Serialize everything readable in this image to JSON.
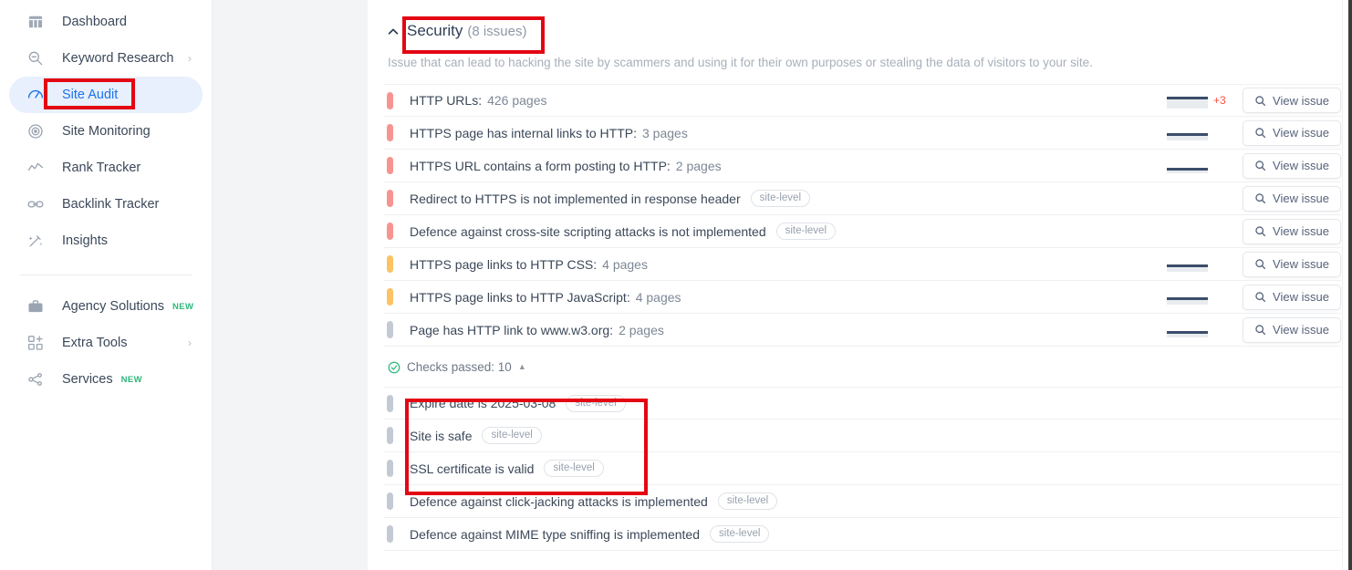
{
  "sidebar": {
    "items": [
      {
        "label": "Dashboard",
        "icon": "dashboard-icon",
        "caret": "",
        "badge": ""
      },
      {
        "label": "Keyword Research",
        "icon": "keyword-research-icon",
        "caret": "›",
        "badge": ""
      },
      {
        "label": "Site Audit",
        "icon": "site-audit-icon",
        "caret": "",
        "badge": "",
        "active": true
      },
      {
        "label": "Site Monitoring",
        "icon": "site-monitoring-icon",
        "caret": "",
        "badge": ""
      },
      {
        "label": "Rank Tracker",
        "icon": "rank-tracker-icon",
        "caret": "",
        "badge": ""
      },
      {
        "label": "Backlink Tracker",
        "icon": "backlink-tracker-icon",
        "caret": "",
        "badge": ""
      },
      {
        "label": "Insights",
        "icon": "insights-icon",
        "caret": "",
        "badge": ""
      }
    ],
    "items_secondary": [
      {
        "label": "Agency Solutions",
        "icon": "briefcase-icon",
        "caret": "",
        "badge": "NEW"
      },
      {
        "label": "Extra Tools",
        "icon": "extra-tools-icon",
        "caret": "›",
        "badge": ""
      },
      {
        "label": "Services",
        "icon": "services-icon",
        "caret": "",
        "badge": "NEW"
      }
    ]
  },
  "section": {
    "title": "Security",
    "count": "(8 issues)",
    "description": "Issue that can lead to hacking the site by scammers and using it for their own purposes or stealing the data of visitors to your site.",
    "collapse_icon": "chevron-up-icon"
  },
  "issues": [
    {
      "severity": "red",
      "label": "HTTP URLs:",
      "count": "426 pages",
      "pill": "",
      "spark": true,
      "spark_fill": 62,
      "delta": "+3",
      "button": "View issue"
    },
    {
      "severity": "red",
      "label": "HTTPS page has internal links to HTTP:",
      "count": "3 pages",
      "pill": "",
      "spark": true,
      "spark_fill": 38,
      "delta": "",
      "button": "View issue"
    },
    {
      "severity": "red",
      "label": "HTTPS URL contains a form posting to HTTP:",
      "count": "2 pages",
      "pill": "",
      "spark": true,
      "spark_fill": 26,
      "delta": "",
      "button": "View issue"
    },
    {
      "severity": "red",
      "label": "Redirect to HTTPS is not implemented in response header",
      "count": "",
      "pill": "site-level",
      "spark": false,
      "spark_fill": 0,
      "delta": "",
      "button": "View issue"
    },
    {
      "severity": "red",
      "label": "Defence against cross-site scripting attacks is not implemented",
      "count": "",
      "pill": "site-level",
      "spark": false,
      "spark_fill": 0,
      "delta": "",
      "button": "View issue"
    },
    {
      "severity": "amber",
      "label": "HTTPS page links to HTTP CSS:",
      "count": "4 pages",
      "pill": "",
      "spark": true,
      "spark_fill": 38,
      "delta": "",
      "button": "View issue"
    },
    {
      "severity": "amber",
      "label": "HTTPS page links to HTTP JavaScript:",
      "count": "4 pages",
      "pill": "",
      "spark": true,
      "spark_fill": 38,
      "delta": "",
      "button": "View issue"
    },
    {
      "severity": "gray",
      "label": "Page has HTTP link to www.w3.org:",
      "count": "2 pages",
      "pill": "",
      "spark": true,
      "spark_fill": 30,
      "delta": "",
      "button": "View issue"
    }
  ],
  "checks": {
    "icon": "check-circle-icon",
    "label": "Checks passed: 10",
    "caret": "▲",
    "passed": [
      {
        "severity": "gray",
        "label": "Expire date is 2025-03-08",
        "pill": "site-level"
      },
      {
        "severity": "gray",
        "label": "Site is safe",
        "pill": "site-level"
      },
      {
        "severity": "gray",
        "label": "SSL certificate is valid",
        "pill": "site-level"
      },
      {
        "severity": "gray",
        "label": "Defence against click-jacking attacks is implemented",
        "pill": "site-level"
      },
      {
        "severity": "gray",
        "label": "Defence against MIME type sniffing is implemented",
        "pill": "site-level"
      }
    ]
  },
  "annotations": {
    "accent": "#e30613",
    "boxes": [
      "site-audit",
      "security-title",
      "passed-checks-group"
    ]
  }
}
